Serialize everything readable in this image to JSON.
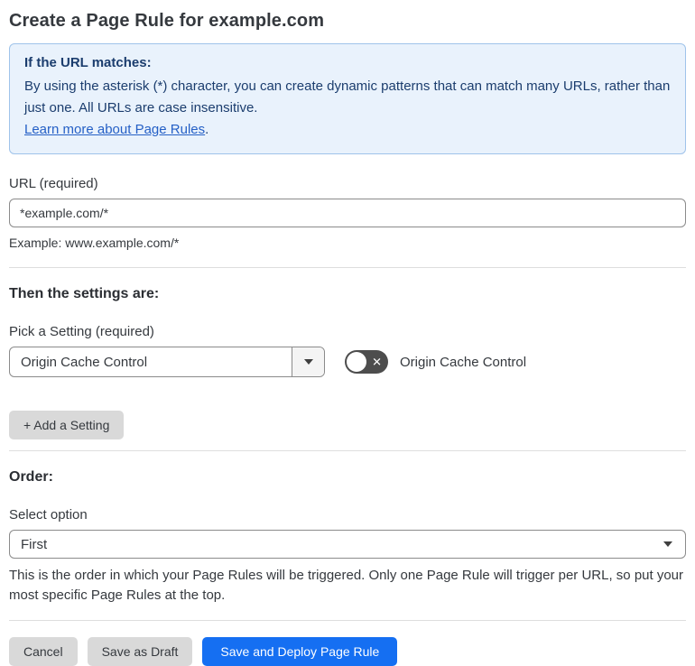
{
  "page": {
    "title": "Create a Page Rule for example.com"
  },
  "info_box": {
    "heading": "If the URL matches:",
    "body": "By using the asterisk (*) character, you can create dynamic patterns that can match many URLs, rather than just one. All URLs are case insensitive.",
    "link_label": "Learn more about Page Rules",
    "link_suffix": "."
  },
  "url_section": {
    "label": "URL (required)",
    "value": "*example.com/*",
    "helper": "Example: www.example.com/*"
  },
  "settings_section": {
    "heading": "Then the settings are:",
    "picker_label": "Pick a Setting (required)",
    "picker_value": "Origin Cache Control",
    "toggle_state": "off",
    "toggle_off_glyph": "✕",
    "toggle_label": "Origin Cache Control",
    "add_button_label": "+ Add a Setting"
  },
  "order_section": {
    "heading": "Order:",
    "select_label": "Select option",
    "select_value": "First",
    "helper": "This is the order in which your Page Rules will be triggered. Only one Page Rule will trigger per URL, so put your most specific Page Rules at the top."
  },
  "footer": {
    "cancel_label": "Cancel",
    "save_draft_label": "Save as Draft",
    "save_deploy_label": "Save and Deploy Page Rule"
  },
  "colors": {
    "accent_blue": "#156ff2",
    "info_background": "#e9f2fc",
    "info_border": "#9fc3ea",
    "info_text": "#1b3d6e",
    "link_blue": "#2560c6",
    "toggle_off_background": "#4d4d4d",
    "gray_button": "#d9d9d9",
    "divider": "#dedede"
  }
}
